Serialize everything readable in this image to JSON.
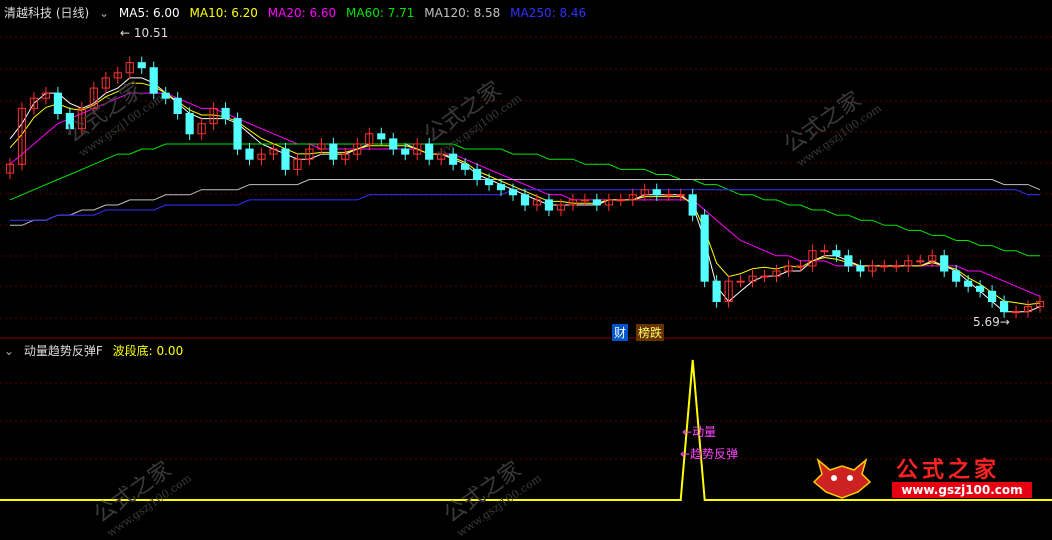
{
  "header_main": {
    "title": "清越科技 (日线)",
    "ma5": "MA5: 6.00",
    "ma10": "MA10: 6.20",
    "ma20": "MA20: 6.60",
    "ma60": "MA60: 7.71",
    "ma120": "MA120: 8.58",
    "ma250": "MA250: 8.46"
  },
  "header_sub": {
    "title": "动量趋势反弹F",
    "value": "波段底: 0.00"
  },
  "labels": {
    "high": "10.51",
    "low": "5.69",
    "badge_fin": "财",
    "badge_drop": "榜跌",
    "ann1": "动量",
    "ann2": "趋势反弹"
  },
  "watermarks": [
    "公式之家",
    "www.gszj100.com"
  ],
  "logo": {
    "name": "公式之家",
    "url": "www.gszj100.com"
  },
  "colors": {
    "up": "#ff3232",
    "down": "#54ffff",
    "ma5": "#ffffff",
    "ma10": "#ffff00",
    "ma20": "#ff00ff",
    "ma60": "#00e600",
    "ma120": "#c0c0c0",
    "ma250": "#3232ff",
    "grid": "#5a0000",
    "signal": "#ffff00"
  },
  "chart_data": {
    "type": "candlestick",
    "price_range": [
      5.3,
      11.4
    ],
    "closes": [
      8.6,
      9.7,
      9.9,
      10.0,
      9.6,
      9.3,
      9.7,
      10.1,
      10.3,
      10.4,
      10.6,
      10.5,
      10.0,
      9.9,
      9.6,
      9.2,
      9.4,
      9.7,
      9.5,
      8.9,
      8.7,
      8.8,
      8.9,
      8.5,
      8.7,
      8.9,
      9.0,
      8.7,
      8.8,
      9.0,
      9.2,
      9.1,
      8.9,
      8.8,
      9.0,
      8.7,
      8.8,
      8.6,
      8.5,
      8.3,
      8.2,
      8.1,
      8.0,
      7.8,
      7.9,
      7.7,
      7.8,
      7.9,
      7.9,
      7.8,
      7.9,
      7.9,
      8.0,
      8.1,
      8.0,
      8.0,
      8.0,
      7.6,
      6.3,
      5.9,
      6.3,
      6.3,
      6.4,
      6.4,
      6.5,
      6.6,
      6.6,
      6.9,
      6.9,
      6.8,
      6.6,
      6.5,
      6.6,
      6.6,
      6.6,
      6.7,
      6.7,
      6.8,
      6.5,
      6.3,
      6.2,
      6.1,
      5.9,
      5.7,
      5.7,
      5.8,
      5.9
    ],
    "ma": {
      "MA5": [
        9.1,
        9.4,
        9.8,
        10.0,
        10.0,
        9.8,
        9.7,
        9.8,
        10.0,
        10.1,
        10.3,
        10.3,
        10.2,
        10.0,
        9.8,
        9.6,
        9.5,
        9.5,
        9.5,
        9.4,
        9.2,
        9.0,
        8.9,
        8.8,
        8.7,
        8.7,
        8.8,
        8.8,
        8.8,
        8.9,
        9.0,
        9.0,
        9.0,
        9.0,
        8.9,
        8.8,
        8.8,
        8.7,
        8.6,
        8.4,
        8.3,
        8.2,
        8.1,
        8.0,
        7.9,
        7.8,
        7.8,
        7.8,
        7.8,
        7.8,
        7.9,
        7.9,
        7.9,
        8.0,
        8.0,
        8.0,
        8.0,
        7.8,
        7.1,
        6.2,
        5.9,
        6.1,
        6.3,
        6.4,
        6.4,
        6.5,
        6.5,
        6.7,
        6.8,
        6.8,
        6.7,
        6.6,
        6.6,
        6.6,
        6.6,
        6.6,
        6.6,
        6.7,
        6.6,
        6.5,
        6.3,
        6.1,
        5.9,
        5.7,
        5.7,
        5.7,
        5.8
      ],
      "MA20": [
        8.6,
        8.8,
        9.0,
        9.2,
        9.4,
        9.5,
        9.6,
        9.7,
        9.8,
        9.9,
        10.0,
        10.0,
        10.0,
        10.0,
        9.9,
        9.8,
        9.7,
        9.7,
        9.6,
        9.5,
        9.4,
        9.3,
        9.2,
        9.1,
        9.0,
        9.0,
        8.9,
        8.9,
        8.9,
        8.9,
        8.9,
        8.9,
        8.9,
        8.9,
        8.9,
        8.8,
        8.8,
        8.8,
        8.7,
        8.6,
        8.5,
        8.4,
        8.3,
        8.2,
        8.1,
        8.0,
        8.0,
        7.9,
        7.9,
        7.9,
        7.9,
        7.9,
        7.9,
        7.9,
        7.9,
        7.9,
        7.9,
        7.9,
        7.7,
        7.5,
        7.3,
        7.1,
        7.0,
        6.9,
        6.8,
        6.8,
        6.7,
        6.7,
        6.7,
        6.6,
        6.6,
        6.6,
        6.6,
        6.6,
        6.6,
        6.6,
        6.6,
        6.6,
        6.6,
        6.6,
        6.5,
        6.5,
        6.4,
        6.3,
        6.2,
        6.1,
        6.0
      ],
      "MA60": [
        7.9,
        8.0,
        8.1,
        8.2,
        8.3,
        8.4,
        8.5,
        8.6,
        8.7,
        8.8,
        8.8,
        8.9,
        8.9,
        9.0,
        9.0,
        9.0,
        9.0,
        9.0,
        9.0,
        9.0,
        9.0,
        9.0,
        9.0,
        9.0,
        9.0,
        9.0,
        9.0,
        9.0,
        9.0,
        9.0,
        9.0,
        9.0,
        9.0,
        9.0,
        9.0,
        9.0,
        9.0,
        9.0,
        8.9,
        8.9,
        8.9,
        8.9,
        8.8,
        8.8,
        8.8,
        8.7,
        8.7,
        8.7,
        8.6,
        8.6,
        8.6,
        8.5,
        8.5,
        8.5,
        8.4,
        8.4,
        8.3,
        8.3,
        8.2,
        8.2,
        8.1,
        8.0,
        8.0,
        7.9,
        7.9,
        7.8,
        7.8,
        7.7,
        7.7,
        7.6,
        7.6,
        7.5,
        7.5,
        7.4,
        7.4,
        7.3,
        7.3,
        7.2,
        7.2,
        7.1,
        7.1,
        7.0,
        7.0,
        6.9,
        6.9,
        6.8,
        6.8
      ],
      "MA120": [
        7.4,
        7.4,
        7.5,
        7.5,
        7.6,
        7.6,
        7.7,
        7.7,
        7.8,
        7.8,
        7.9,
        7.9,
        7.9,
        8.0,
        8.0,
        8.0,
        8.1,
        8.1,
        8.1,
        8.1,
        8.2,
        8.2,
        8.2,
        8.2,
        8.2,
        8.3,
        8.3,
        8.3,
        8.3,
        8.3,
        8.3,
        8.3,
        8.3,
        8.3,
        8.3,
        8.3,
        8.3,
        8.3,
        8.3,
        8.3,
        8.3,
        8.3,
        8.3,
        8.3,
        8.3,
        8.3,
        8.3,
        8.3,
        8.3,
        8.3,
        8.3,
        8.3,
        8.3,
        8.3,
        8.3,
        8.3,
        8.3,
        8.3,
        8.3,
        8.3,
        8.3,
        8.3,
        8.3,
        8.3,
        8.3,
        8.3,
        8.3,
        8.3,
        8.3,
        8.3,
        8.3,
        8.3,
        8.3,
        8.3,
        8.3,
        8.3,
        8.3,
        8.3,
        8.3,
        8.3,
        8.3,
        8.3,
        8.3,
        8.2,
        8.2,
        8.2,
        8.1
      ],
      "MA250": [
        7.5,
        7.5,
        7.5,
        7.5,
        7.6,
        7.6,
        7.6,
        7.6,
        7.7,
        7.7,
        7.7,
        7.7,
        7.7,
        7.8,
        7.8,
        7.8,
        7.8,
        7.8,
        7.8,
        7.8,
        7.9,
        7.9,
        7.9,
        7.9,
        7.9,
        7.9,
        7.9,
        7.9,
        7.9,
        7.9,
        8.0,
        8.0,
        8.0,
        8.0,
        8.0,
        8.0,
        8.0,
        8.0,
        8.0,
        8.0,
        8.0,
        8.0,
        8.1,
        8.1,
        8.1,
        8.1,
        8.1,
        8.1,
        8.1,
        8.1,
        8.1,
        8.1,
        8.1,
        8.1,
        8.1,
        8.1,
        8.1,
        8.1,
        8.1,
        8.1,
        8.1,
        8.1,
        8.1,
        8.1,
        8.1,
        8.1,
        8.1,
        8.1,
        8.1,
        8.1,
        8.1,
        8.1,
        8.1,
        8.1,
        8.1,
        8.1,
        8.1,
        8.1,
        8.1,
        8.1,
        8.1,
        8.1,
        8.1,
        8.1,
        8.1,
        8.0,
        8.0
      ]
    },
    "signal_peak_index": 57,
    "signal_range": [
      0,
      1
    ]
  }
}
